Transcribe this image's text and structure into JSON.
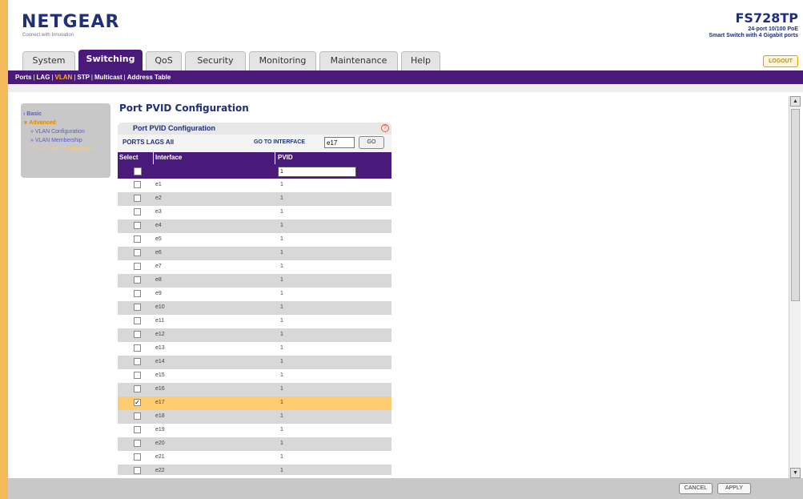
{
  "header": {
    "logo": "NETGEAR",
    "logo_tagline": "Connect with Innovation",
    "model": "FS728TP",
    "model_desc_line1": "24-port 10/100 PoE",
    "model_desc_line2": "Smart Switch with 4 Gigabit ports"
  },
  "tabs": [
    {
      "label": "System",
      "active": false
    },
    {
      "label": "Switching",
      "active": true
    },
    {
      "label": "QoS",
      "active": false
    },
    {
      "label": "Security",
      "active": false
    },
    {
      "label": "Monitoring",
      "active": false
    },
    {
      "label": "Maintenance",
      "active": false
    },
    {
      "label": "Help",
      "active": false
    }
  ],
  "logout_label": "LOGOUT",
  "subnav": [
    {
      "label": "Ports",
      "active": false
    },
    {
      "label": "LAG",
      "active": false
    },
    {
      "label": "VLAN",
      "active": true
    },
    {
      "label": "STP",
      "active": false
    },
    {
      "label": "Multicast",
      "active": false
    },
    {
      "label": "Address Table",
      "active": false
    }
  ],
  "sidenav": {
    "basic": "Basic",
    "advanced": "Advanced",
    "items": [
      {
        "label": "VLAN Configuration",
        "active": false
      },
      {
        "label": "VLAN Membership",
        "active": false
      },
      {
        "label": "Port PVID Configuration",
        "active": true
      }
    ]
  },
  "page_title": "Port PVID Configuration",
  "panel": {
    "title": "Port PVID Configuration",
    "help_icon": "?",
    "filter": "PORTS LAGS All",
    "goto_label": "GO TO INTERFACE",
    "goto_value": "e17",
    "go_label": "GO"
  },
  "table": {
    "headers": {
      "select": "Select",
      "interface": "Interface",
      "pvid": "PVID"
    },
    "edit_pvid_value": "1",
    "rows": [
      {
        "interface": "e1",
        "pvid": "1",
        "checked": false,
        "highlight": false
      },
      {
        "interface": "e2",
        "pvid": "1",
        "checked": false,
        "highlight": false
      },
      {
        "interface": "e3",
        "pvid": "1",
        "checked": false,
        "highlight": false
      },
      {
        "interface": "e4",
        "pvid": "1",
        "checked": false,
        "highlight": false
      },
      {
        "interface": "e5",
        "pvid": "1",
        "checked": false,
        "highlight": false
      },
      {
        "interface": "e6",
        "pvid": "1",
        "checked": false,
        "highlight": false
      },
      {
        "interface": "e7",
        "pvid": "1",
        "checked": false,
        "highlight": false
      },
      {
        "interface": "e8",
        "pvid": "1",
        "checked": false,
        "highlight": false
      },
      {
        "interface": "e9",
        "pvid": "1",
        "checked": false,
        "highlight": false
      },
      {
        "interface": "e10",
        "pvid": "1",
        "checked": false,
        "highlight": false
      },
      {
        "interface": "e11",
        "pvid": "1",
        "checked": false,
        "highlight": false
      },
      {
        "interface": "e12",
        "pvid": "1",
        "checked": false,
        "highlight": false
      },
      {
        "interface": "e13",
        "pvid": "1",
        "checked": false,
        "highlight": false
      },
      {
        "interface": "e14",
        "pvid": "1",
        "checked": false,
        "highlight": false
      },
      {
        "interface": "e15",
        "pvid": "1",
        "checked": false,
        "highlight": false
      },
      {
        "interface": "e16",
        "pvid": "1",
        "checked": false,
        "highlight": false
      },
      {
        "interface": "e17",
        "pvid": "1",
        "checked": true,
        "highlight": true
      },
      {
        "interface": "e18",
        "pvid": "1",
        "checked": false,
        "highlight": false
      },
      {
        "interface": "e19",
        "pvid": "1",
        "checked": false,
        "highlight": false
      },
      {
        "interface": "e20",
        "pvid": "1",
        "checked": false,
        "highlight": false
      },
      {
        "interface": "e21",
        "pvid": "1",
        "checked": false,
        "highlight": false
      },
      {
        "interface": "e22",
        "pvid": "1",
        "checked": false,
        "highlight": false
      }
    ]
  },
  "footer": {
    "cancel": "CANCEL",
    "apply": "APPLY"
  },
  "colors": {
    "brand_purple": "#4a1a7a",
    "highlight_row": "#ffcc70",
    "left_bar": "#f4b95a",
    "navy_text": "#1f2f7a"
  }
}
